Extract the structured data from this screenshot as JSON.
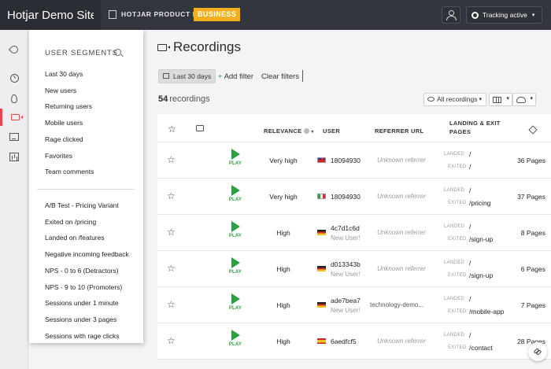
{
  "topbar": {
    "site_name": "Hotjar Demo Site",
    "org_name": "HOTJAR PRODUCT DEMO",
    "plan_badge": "BUSINESS",
    "tracking_label": "Tracking active",
    "colors": {
      "topbar": "#33363f",
      "badge": "#f2b01e"
    }
  },
  "rail": {
    "icons": [
      "rocket-icon",
      "dashboard-icon",
      "heatmap-icon",
      "recordings-icon",
      "feedback-icon",
      "analytics-icon"
    ],
    "active": "recordings-icon",
    "accent": "#f0444c"
  },
  "main": {
    "title": "Recordings",
    "filters": {
      "chip_label": "Last 30 days",
      "add_filter": "Add filter",
      "add_filter_icon": "+",
      "clear_filters": "Clear filters"
    },
    "count": "54",
    "count_label": "recordings",
    "all_recordings_label": "All recordings"
  },
  "table": {
    "headers": {
      "relevance": "RELEVANCE",
      "user": "USER",
      "referrer": "REFERRER URL",
      "landing_exit": "LANDING & EXIT",
      "landing_exit_2": "PAGES"
    },
    "play_label": "PLAY",
    "landed_label": "LANDED",
    "exited_label": "EXITED",
    "rows": [
      {
        "relevance": "Very high",
        "flag": "gb",
        "user": "18094930",
        "new_user": "",
        "referrer": "Unknown referrer",
        "landed": "/",
        "exited": "/",
        "pages": "36 Pages"
      },
      {
        "relevance": "Very high",
        "flag": "it",
        "user": "18094930",
        "new_user": "",
        "referrer": "Unknown referrer",
        "landed": "/",
        "exited": "/pricing",
        "pages": "37 Pages"
      },
      {
        "relevance": "High",
        "flag": "de",
        "user": "4c7d1c6d",
        "new_user": "New User!",
        "referrer": "Unknown referrer",
        "landed": "/",
        "exited": "/sign-up",
        "pages": "8 Pages"
      },
      {
        "relevance": "High",
        "flag": "de",
        "user": "d013343b",
        "new_user": "New User!",
        "referrer": "Unknown referrer",
        "landed": "/",
        "exited": "/sign-up",
        "pages": "6 Pages"
      },
      {
        "relevance": "High",
        "flag": "de",
        "user": "ade7bea7",
        "new_user": "New User!",
        "referrer": "technology-demo...",
        "landed": "/",
        "exited": "/mobile-app",
        "pages": "7 Pages"
      },
      {
        "relevance": "High",
        "flag": "es",
        "user": "6aedfcf5",
        "new_user": "",
        "referrer": "Unknown referrer",
        "landed": "/",
        "exited": "/contact",
        "pages": "28 Pages"
      }
    ],
    "play_color": "#2f9d41"
  },
  "segments": {
    "header": "USER SEGMENTS",
    "default_items": [
      "Last 30 days",
      "New users",
      "Returning users",
      "Mobile users",
      "Rage clicked",
      "Favorites",
      "Team comments"
    ],
    "custom_items": [
      "A/B Test - Pricing Variant",
      "Exited on /pricing",
      "Landed on /features",
      "Negative incoming feedback",
      "NPS - 0 to 6 (Detractors)",
      "NPS - 9 to 10 (Promoters)",
      "Sessions under 1 minute",
      "Sessions under 3 pages",
      "Sessions with rage clicks"
    ]
  }
}
